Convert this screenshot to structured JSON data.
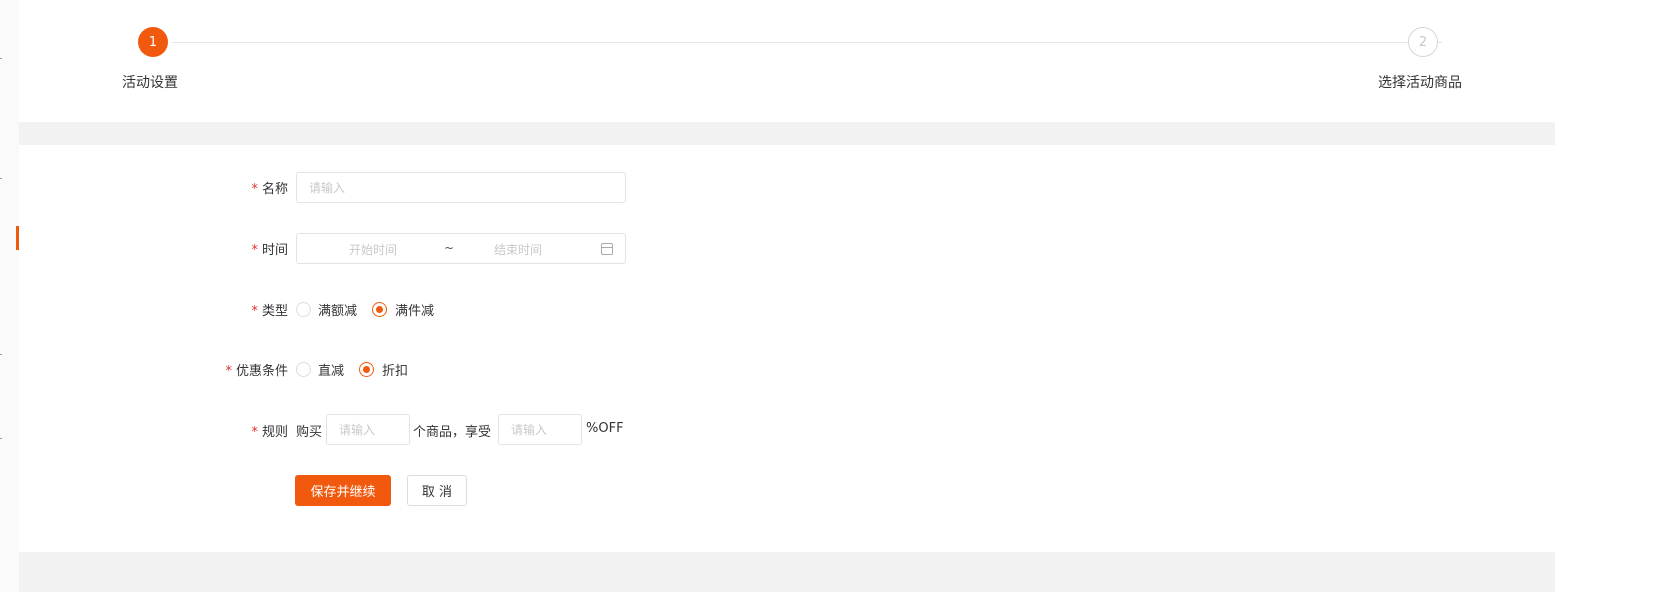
{
  "steps": [
    {
      "number": "1",
      "label": "活动设置"
    },
    {
      "number": "2",
      "label": "选择活动商品"
    }
  ],
  "form": {
    "name": {
      "label": "名称",
      "placeholder": "请输入"
    },
    "time": {
      "label": "时间",
      "start_placeholder": "开始时间",
      "separator": "~",
      "end_placeholder": "结束时间"
    },
    "type": {
      "label": "类型",
      "options": [
        "满额减",
        "满件减"
      ],
      "selected": "满件减"
    },
    "discount_condition": {
      "label": "优惠条件",
      "options": [
        "直减",
        "折扣"
      ],
      "selected": "折扣"
    },
    "rule": {
      "label": "规则",
      "prefix": "购买",
      "qty_placeholder": "请输入",
      "middle": "个商品，享受",
      "pct_placeholder": "请输入",
      "suffix": "%OFF"
    }
  },
  "buttons": {
    "save": "保存并继续",
    "cancel": "取 消"
  },
  "required_mark": "*",
  "colors": {
    "accent": "#f15a0e",
    "required": "#e0302a"
  }
}
